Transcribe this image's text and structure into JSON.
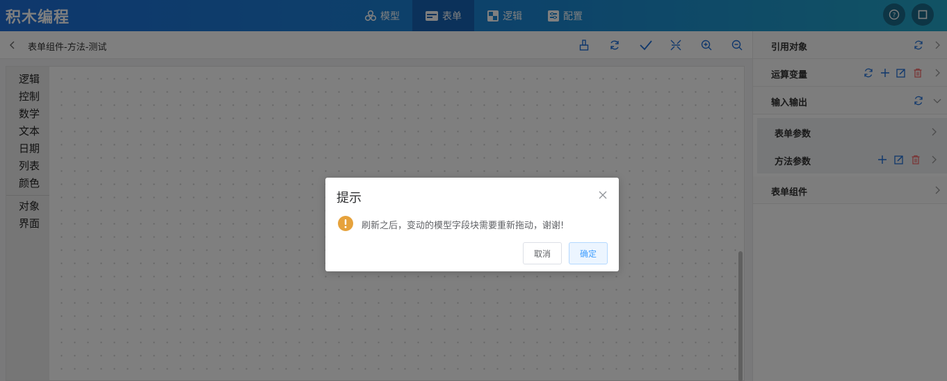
{
  "app": {
    "title": "积木编程"
  },
  "nav": {
    "tabs": [
      {
        "label": "模型",
        "icon": "cubes-icon"
      },
      {
        "label": "表单",
        "icon": "form-icon",
        "active": true
      },
      {
        "label": "逻辑",
        "icon": "puzzle-icon"
      },
      {
        "label": "配置",
        "icon": "settings-panel-icon"
      }
    ]
  },
  "top_icons": [
    "help-icon",
    "fullscreen-icon"
  ],
  "subbar": {
    "breadcrumb": "表单组件-方法-测试",
    "tools": [
      "clean-icon",
      "refresh-icon",
      "check-icon",
      "collapse-icon",
      "zoom-in-icon",
      "zoom-out-icon"
    ]
  },
  "toolbox": {
    "categories_group1": [
      "逻辑",
      "控制",
      "数学",
      "文本",
      "日期",
      "列表",
      "颜色"
    ],
    "categories_group2": [
      "对象",
      "界面"
    ]
  },
  "right_panel": {
    "ref_objects": "引用对象",
    "calc_vars": "运算变量",
    "io": "输入输出",
    "form_params": "表单参数",
    "method_params": "方法参数",
    "form_components": "表单组件"
  },
  "dialog": {
    "title": "提示",
    "message": "刷新之后，变动的模型字段块需要重新拖动，谢谢!",
    "cancel": "取消",
    "confirm": "确定"
  },
  "colors": {
    "accent": "#409eff",
    "warning": "#e6a23c",
    "danger": "#f56c6c",
    "topbar": "#1e6fd9"
  }
}
